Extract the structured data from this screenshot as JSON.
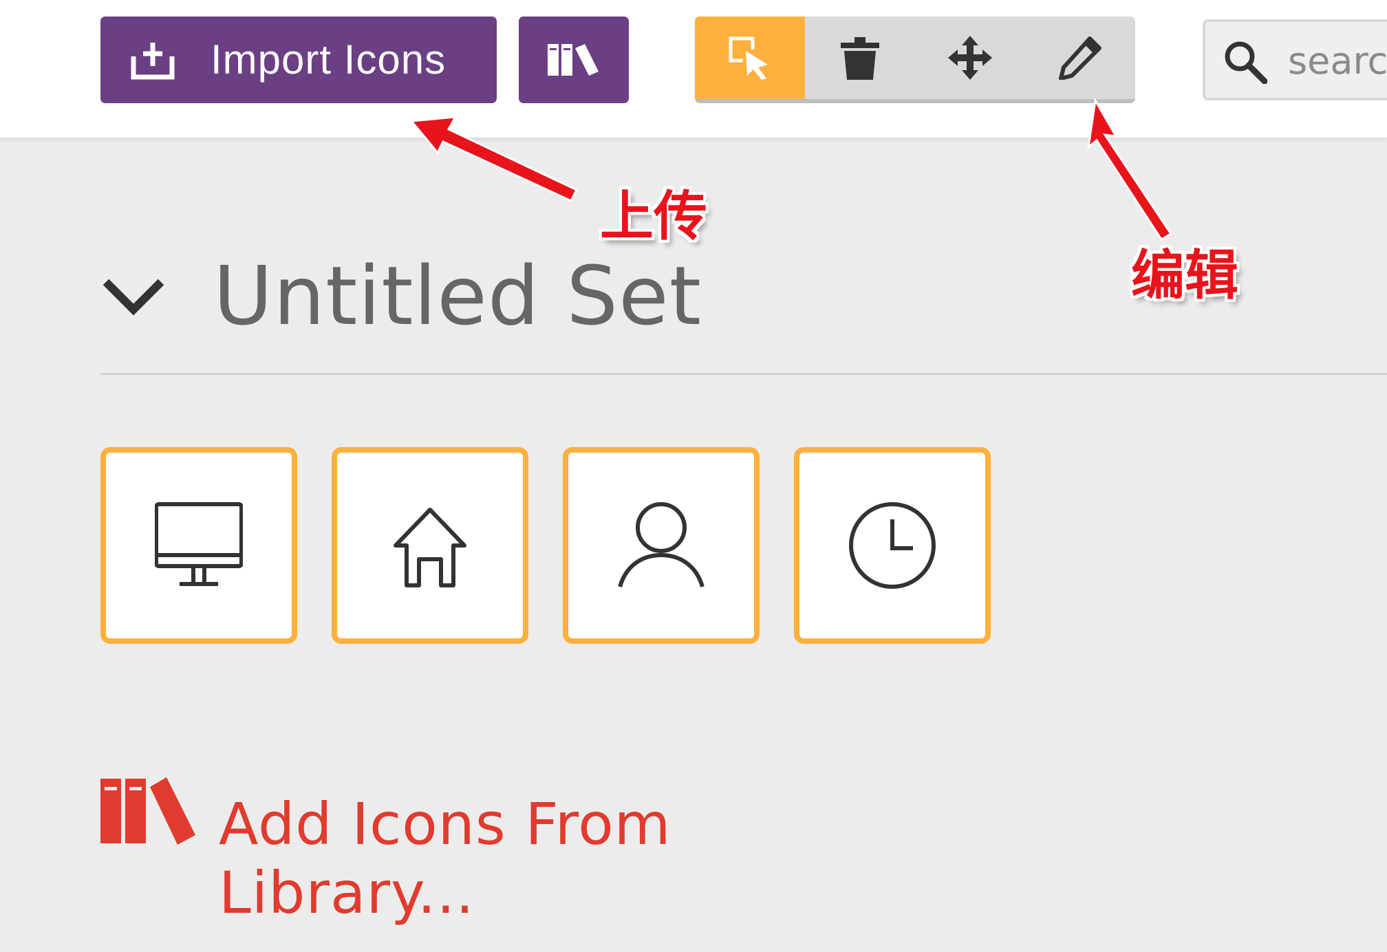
{
  "toolbar": {
    "import_button_label": "Import Icons",
    "import_icon": "import-icon",
    "library_icon": "library-icon",
    "tools": [
      {
        "name": "select-tool",
        "icon": "select-cursor-icon",
        "active": true
      },
      {
        "name": "delete-tool",
        "icon": "trash-icon",
        "active": false
      },
      {
        "name": "move-tool",
        "icon": "move-arrows-icon",
        "active": false
      },
      {
        "name": "edit-tool",
        "icon": "pencil-icon",
        "active": false
      }
    ],
    "search_placeholder": "search"
  },
  "annotations": {
    "upload_label": "上传",
    "edit_label": "编辑"
  },
  "set": {
    "title": "Untitled Set",
    "icons": [
      {
        "name": "monitor-icon"
      },
      {
        "name": "home-icon"
      },
      {
        "name": "user-icon"
      },
      {
        "name": "clock-icon"
      }
    ]
  },
  "add_library_label": "Add Icons From Library...",
  "colors": {
    "brand_purple": "#6b3f84",
    "accent_orange": "#fdb03d",
    "library_red": "#e03b2e",
    "annotation_red": "#e8141c"
  }
}
